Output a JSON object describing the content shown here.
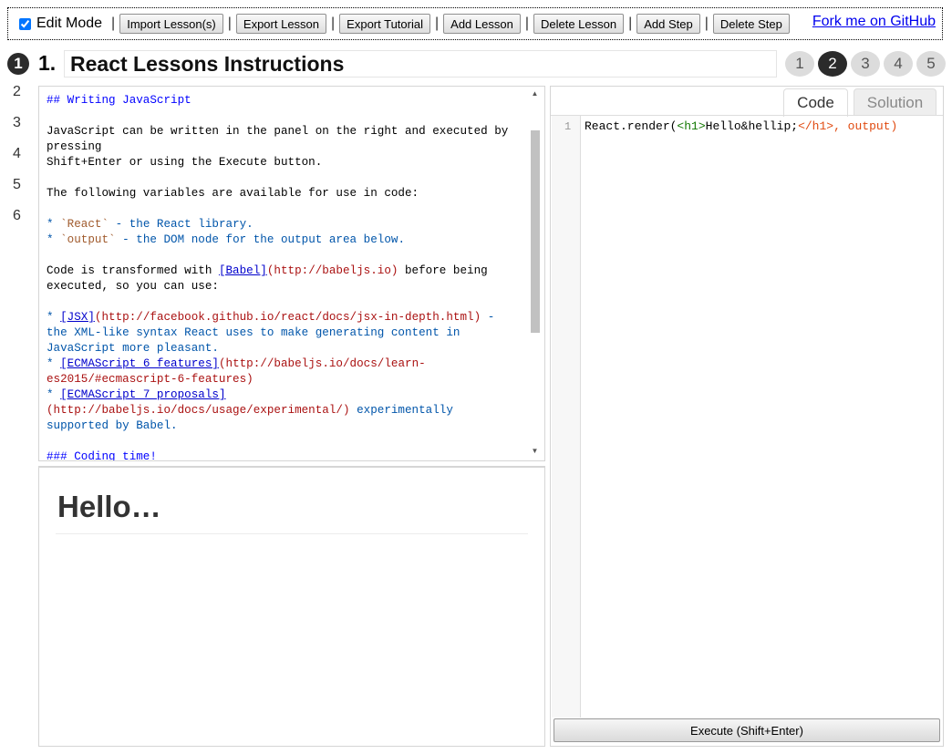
{
  "toolbar": {
    "edit_mode_label": "Edit Mode",
    "separator": "|",
    "import_label": "Import Lesson(s)",
    "export_lesson_label": "Export Lesson",
    "export_tutorial_label": "Export Tutorial",
    "add_lesson_label": "Add Lesson",
    "delete_lesson_label": "Delete Lesson",
    "add_step_label": "Add Step",
    "delete_step_label": "Delete Step",
    "github_label": "Fork me on GitHub"
  },
  "lesson": {
    "badge": "1",
    "number_label": "1.",
    "title_value": "React Lessons Instructions"
  },
  "steps": [
    "1",
    "2",
    "3",
    "4",
    "5"
  ],
  "active_step": "2",
  "lesson_list": [
    "2",
    "3",
    "4",
    "5",
    "6"
  ],
  "instructions": {
    "heading": "## Writing JavaScript",
    "p1": "JavaScript can be written in the panel on the right and executed by pressing\nShift+Enter or using the Execute button.",
    "p2": "The following variables are available for use in code:",
    "li1_star": "* ",
    "li1_code": "`React`",
    "li1_text": " - the React library.",
    "li2_star": "* ",
    "li2_code": "`output`",
    "li2_text": " - the DOM node for the output area below.",
    "p3_a": "Code is transformed with ",
    "p3_link": "[Babel]",
    "p3_url": "(http://babeljs.io)",
    "p3_b": " before being\nexecuted, so you can use:",
    "b1_star": "* ",
    "b1_link": "[JSX]",
    "b1_url": "(http://facebook.github.io/react/docs/jsx-in-depth.html)",
    "b1_text": " -\nthe XML-like syntax React uses to make generating content in\nJavaScript more pleasant.",
    "b2_star": "* ",
    "b2_link": "[ECMAScript 6 features]",
    "b2_url": "(http://babeljs.io/docs/learn-\nes2015/#ecmascript-6-features)",
    "b3_star": "* ",
    "b3_link": "[ECMAScript 7 proposals]",
    "b3_url": "\n(http://babeljs.io/docs/usage/experimental/)",
    "b3_text": " experimentally\nsupported by Babel.",
    "heading2": "### Coding time!"
  },
  "output": {
    "heading": "Hello…"
  },
  "code_panel": {
    "tab_code": "Code",
    "tab_solution": "Solution",
    "line_number": "1",
    "code_prefix": "React.render(",
    "code_tag_open": "<h1>",
    "code_content": "Hello&hellip;",
    "code_tag_close": "</h1>",
    "code_suffix": ", output)",
    "execute_label": "Execute (Shift+Enter)"
  },
  "colors": {
    "heading_blue": "#0000ff",
    "link_blue": "#0000cc",
    "url_red": "#aa1111",
    "code_orange": "#e04a10",
    "step_active": "#2b2b2b"
  }
}
